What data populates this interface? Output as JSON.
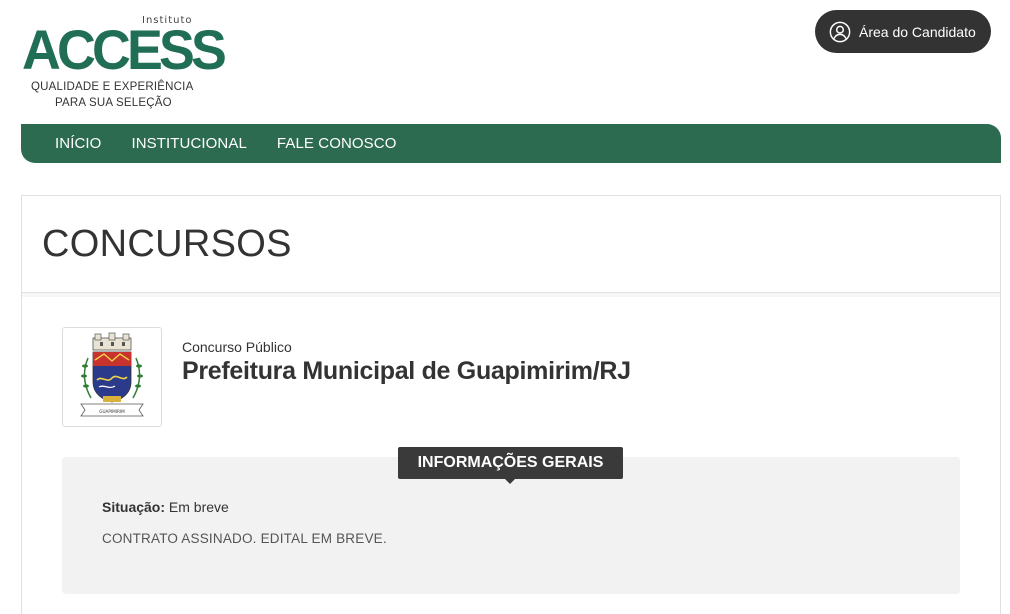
{
  "logo": {
    "instituto": "Instituto",
    "access": "ACCESS",
    "tagline_line1": "QUALIDADE E EXPERIÊNCIA",
    "tagline_line2": "PARA SUA SELEÇÃO",
    "brand_color": "#1f6e55"
  },
  "header": {
    "candidate_button_label": "Área do Candidato",
    "candidate_icon": "user-circle-icon"
  },
  "nav": {
    "items": [
      "INÍCIO",
      "INSTITUCIONAL",
      "FALE CONOSCO"
    ],
    "background": "#2d6b50"
  },
  "page": {
    "title": "CONCURSOS"
  },
  "contest": {
    "kind": "Concurso Público",
    "name": "Prefeitura Municipal de Guapimirim/RJ",
    "crest_icon": "municipal-coat-of-arms",
    "crest_ribbon_text": "GUAPIMIRIM"
  },
  "info": {
    "tab_label": "INFORMAÇÕES GERAIS",
    "status_label": "Situação:",
    "status_value": "Em breve",
    "note": "CONTRATO ASSINADO. EDITAL EM BREVE."
  }
}
